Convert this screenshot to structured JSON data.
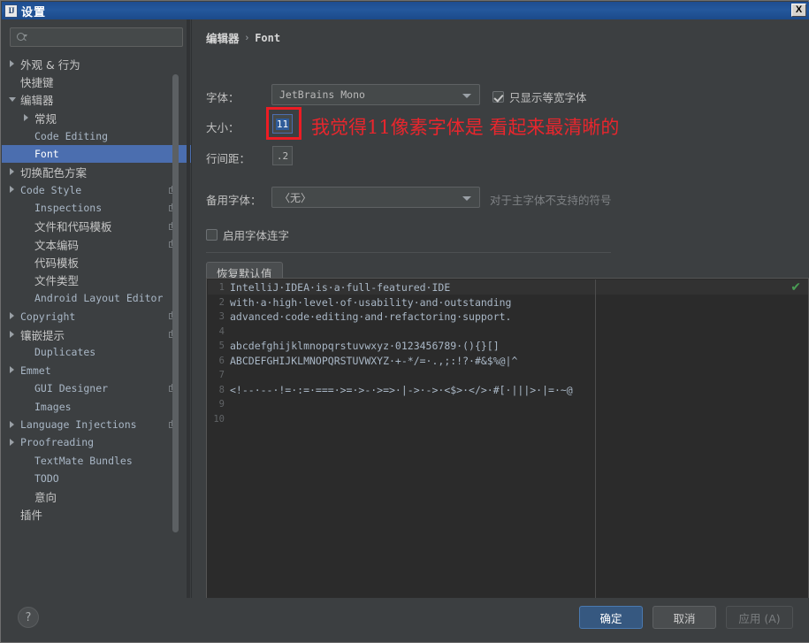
{
  "window": {
    "title": "设置",
    "app_icon_text": "IJ",
    "close_label": "X"
  },
  "sidebar": {
    "search": {
      "placeholder": "",
      "value": "",
      "icon": "search-icon"
    },
    "items": [
      {
        "label": "外观 & 行为",
        "indent": 1,
        "arrow": "closed",
        "kind": "cjk",
        "copy": false,
        "selected": false
      },
      {
        "label": "快捷键",
        "indent": 1,
        "arrow": "none",
        "kind": "cjk",
        "copy": false,
        "selected": false
      },
      {
        "label": "编辑器",
        "indent": 1,
        "arrow": "open",
        "kind": "cjk",
        "copy": false,
        "selected": false
      },
      {
        "label": "常规",
        "indent": 2,
        "arrow": "closed",
        "kind": "cjk",
        "copy": false,
        "selected": false
      },
      {
        "label": "Code Editing",
        "indent": 2,
        "arrow": "none",
        "kind": "mono",
        "copy": false,
        "selected": false
      },
      {
        "label": "Font",
        "indent": 2,
        "arrow": "none",
        "kind": "mono",
        "copy": false,
        "selected": true
      },
      {
        "label": "切换配色方案",
        "indent": 1,
        "arrow": "closed",
        "kind": "cjk",
        "copy": false,
        "selected": false
      },
      {
        "label": "Code Style",
        "indent": 1,
        "arrow": "closed",
        "kind": "mono",
        "copy": true,
        "selected": false
      },
      {
        "label": "Inspections",
        "indent": 2,
        "arrow": "none",
        "kind": "mono",
        "copy": true,
        "selected": false
      },
      {
        "label": "文件和代码模板",
        "indent": 2,
        "arrow": "none",
        "kind": "cjk",
        "copy": true,
        "selected": false
      },
      {
        "label": "文本编码",
        "indent": 2,
        "arrow": "none",
        "kind": "cjk",
        "copy": true,
        "selected": false
      },
      {
        "label": "代码模板",
        "indent": 2,
        "arrow": "none",
        "kind": "cjk",
        "copy": false,
        "selected": false
      },
      {
        "label": "文件类型",
        "indent": 2,
        "arrow": "none",
        "kind": "cjk",
        "copy": false,
        "selected": false
      },
      {
        "label": "Android Layout Editor",
        "indent": 2,
        "arrow": "none",
        "kind": "mono",
        "copy": false,
        "selected": false
      },
      {
        "label": "Copyright",
        "indent": 1,
        "arrow": "closed",
        "kind": "mono",
        "copy": true,
        "selected": false
      },
      {
        "label": "镶嵌提示",
        "indent": 1,
        "arrow": "closed",
        "kind": "cjk",
        "copy": true,
        "selected": false
      },
      {
        "label": "Duplicates",
        "indent": 2,
        "arrow": "none",
        "kind": "mono",
        "copy": false,
        "selected": false
      },
      {
        "label": "Emmet",
        "indent": 1,
        "arrow": "closed",
        "kind": "mono",
        "copy": false,
        "selected": false
      },
      {
        "label": "GUI Designer",
        "indent": 2,
        "arrow": "none",
        "kind": "mono",
        "copy": true,
        "selected": false
      },
      {
        "label": "Images",
        "indent": 2,
        "arrow": "none",
        "kind": "mono",
        "copy": false,
        "selected": false
      },
      {
        "label": "Language Injections",
        "indent": 1,
        "arrow": "closed",
        "kind": "mono",
        "copy": true,
        "selected": false
      },
      {
        "label": "Proofreading",
        "indent": 1,
        "arrow": "closed",
        "kind": "mono",
        "copy": false,
        "selected": false
      },
      {
        "label": "TextMate Bundles",
        "indent": 2,
        "arrow": "none",
        "kind": "mono",
        "copy": false,
        "selected": false
      },
      {
        "label": "TODO",
        "indent": 2,
        "arrow": "none",
        "kind": "mono",
        "copy": false,
        "selected": false
      },
      {
        "label": "意向",
        "indent": 2,
        "arrow": "none",
        "kind": "cjk",
        "copy": false,
        "selected": false
      },
      {
        "label": "插件",
        "indent": 1,
        "arrow": "none",
        "kind": "cjk",
        "copy": false,
        "selected": false
      }
    ]
  },
  "main": {
    "breadcrumb": {
      "parent": "编辑器",
      "separator": "›",
      "current": "Font"
    },
    "font_row": {
      "label": "字体：",
      "value": "JetBrains Mono"
    },
    "monospace_checkbox": {
      "label": "只显示等宽字体",
      "checked": true
    },
    "size_row": {
      "label": "大小：",
      "value": "11"
    },
    "line_height_row": {
      "label": "行间距：",
      "value": ".2"
    },
    "fallback_row": {
      "label": "备用字体：",
      "value": "〈无〉",
      "hint": "对于主字体不支持的符号"
    },
    "ligatures_checkbox": {
      "label": "启用字体连字",
      "checked": false
    },
    "restore_button": "恢复默认值"
  },
  "annotation": {
    "text": "我觉得11像素字体是 看起来最清晰的",
    "color": "#e8262d",
    "highlight_box_color": "#ec1c24"
  },
  "preview": {
    "status_icon": "check-icon",
    "lines": [
      {
        "num": "1",
        "text": "IntelliJ·IDEA·is·a·full-featured·IDE"
      },
      {
        "num": "2",
        "text": "with·a·high·level·of·usability·and·outstanding"
      },
      {
        "num": "3",
        "text": "advanced·code·editing·and·refactoring·support."
      },
      {
        "num": "4",
        "text": ""
      },
      {
        "num": "5",
        "text": "abcdefghijklmnopqrstuvwxyz·0123456789·(){}[]"
      },
      {
        "num": "6",
        "text": "ABCDEFGHIJKLMNOPQRSTUVWXYZ·+-*/=·.,;:!?·#&$%@|^"
      },
      {
        "num": "7",
        "text": ""
      },
      {
        "num": "8",
        "text": "<!--·--·!=·:=·===·>=·>-·>=>·|->·->·<$>·</>·#[·|||>·|=·~@"
      },
      {
        "num": "9",
        "text": ""
      },
      {
        "num": "10",
        "text": ""
      }
    ]
  },
  "footer": {
    "help": "?",
    "ok": "确定",
    "cancel": "取消",
    "apply": "应用 (A)"
  }
}
